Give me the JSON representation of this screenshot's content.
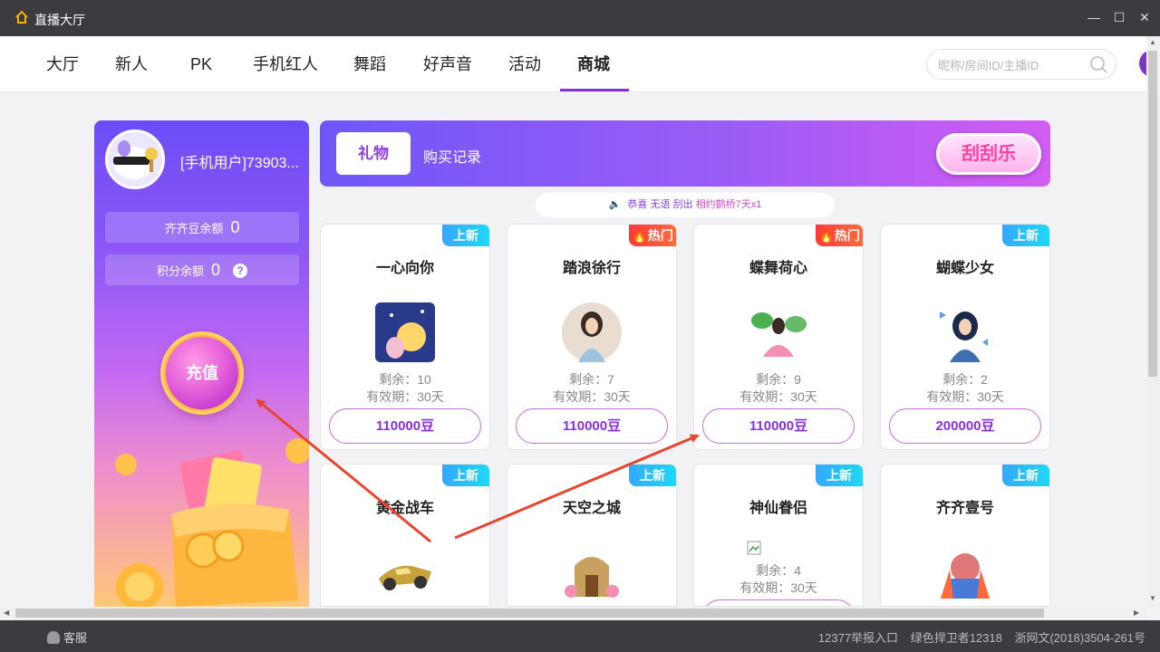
{
  "window": {
    "title": "直播大厅"
  },
  "nav": {
    "tabs": [
      "大厅",
      "新人",
      "PK",
      "手机红人",
      "舞蹈",
      "好声音",
      "活动",
      "商城"
    ],
    "active": "商城",
    "search_placeholder": "昵称/房间ID/主播ID"
  },
  "user": {
    "name": "[手机用户]73903...",
    "bean_label": "齐齐豆余额",
    "bean_value": "0",
    "points_label": "积分余额",
    "points_value": "0",
    "help": "?",
    "recharge": "充值"
  },
  "shop": {
    "tab_gift": "礼物",
    "tab_record": "购买记录",
    "scratch": "刮刮乐",
    "notice": {
      "prefix": "恭喜",
      "user": "无语",
      "action": "刮出",
      "prize": "相约鹊桥7天x1"
    }
  },
  "cards": [
    {
      "badge": "上新",
      "badge_type": "new",
      "name": "一心向你",
      "stock": "剩余：10",
      "valid": "有效期：30天",
      "price": "110000豆"
    },
    {
      "badge": "热门",
      "badge_type": "hot",
      "name": "踏浪徐行",
      "stock": "剩余：7",
      "valid": "有效期：30天",
      "price": "110000豆"
    },
    {
      "badge": "热门",
      "badge_type": "hot",
      "name": "蝶舞荷心",
      "stock": "剩余：9",
      "valid": "有效期：30天",
      "price": "110000豆"
    },
    {
      "badge": "上新",
      "badge_type": "new",
      "name": "蝴蝶少女",
      "stock": "剩余：2",
      "valid": "有效期：30天",
      "price": "200000豆"
    },
    {
      "badge": "上新",
      "badge_type": "new",
      "name": "黄金战车"
    },
    {
      "badge": "上新",
      "badge_type": "new",
      "name": "天空之城"
    },
    {
      "badge": "上新",
      "badge_type": "new",
      "name": "神仙眷侣",
      "stock": "剩余：4",
      "valid": "有效期：30天"
    },
    {
      "badge": "上新",
      "badge_type": "new",
      "name": "齐齐壹号"
    }
  ],
  "footer": {
    "service": "客服",
    "links": [
      "12377举报入口",
      "绿色捍卫者12318",
      "浙网文(2018)3504-261号"
    ]
  },
  "colors": {
    "accent": "#8b2fd9",
    "titlebar": "#3b3b40",
    "annotation": "#e8452f"
  }
}
